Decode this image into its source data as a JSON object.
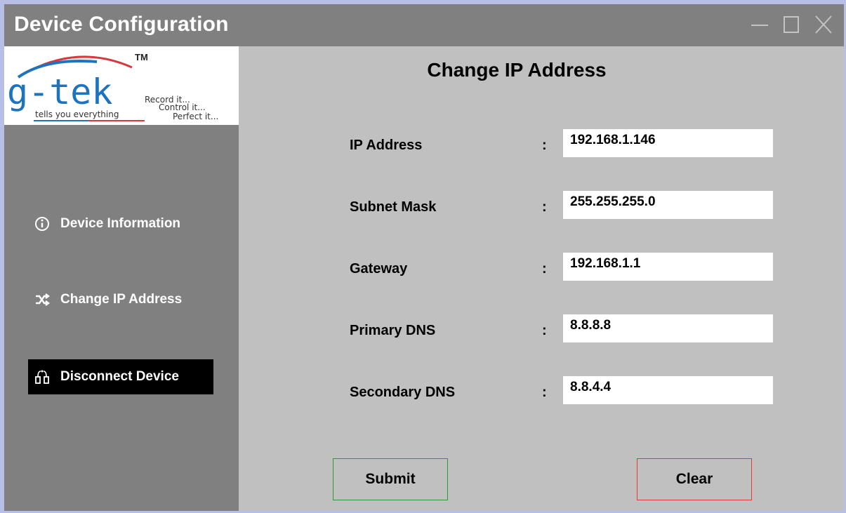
{
  "window": {
    "title": "Device Configuration"
  },
  "titlebar_controls": {
    "minimize_icon": "minimize-icon",
    "maximize_icon": "maximize-icon",
    "close_icon": "close-icon"
  },
  "logo": {
    "name": "g-tek",
    "trademark": "TM",
    "tagline": "tells you everything",
    "motto_1": "Record it...",
    "motto_2": "Control it...",
    "motto_3": "Perfect it..."
  },
  "sidebar": {
    "items": [
      {
        "label": "Device Information",
        "icon": "info-icon",
        "active": false
      },
      {
        "label": "Change IP Address",
        "icon": "shuffle-icon",
        "active": false
      },
      {
        "label": "Disconnect Device",
        "icon": "disconnect-icon",
        "active": true
      }
    ]
  },
  "main": {
    "title": "Change IP Address",
    "colon": ":",
    "fields": [
      {
        "label": "IP Address",
        "value": "192.168.1.146"
      },
      {
        "label": "Subnet Mask",
        "value": "255.255.255.0"
      },
      {
        "label": "Gateway",
        "value": "192.168.1.1"
      },
      {
        "label": "Primary DNS",
        "value": "8.8.8.8"
      },
      {
        "label": "Secondary DNS",
        "value": "8.8.4.4"
      }
    ],
    "submit_label": "Submit",
    "clear_label": "Clear"
  },
  "colors": {
    "titlebar": "#808080",
    "sidebar": "#808080",
    "content_background": "#c0c0c0",
    "active_nav": "#000000",
    "submit_border": "#2e9a3c",
    "clear_border": "#e03a3a",
    "logo_accent_blue": "#1e73be",
    "logo_accent_red": "#d9363e"
  }
}
